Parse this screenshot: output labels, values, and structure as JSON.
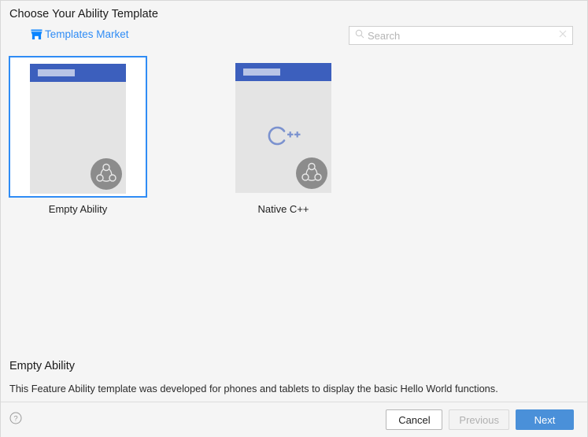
{
  "header": {
    "title": "Choose Your Ability Template",
    "market_link_label": "Templates Market",
    "market_icon": "shop-icon"
  },
  "search": {
    "placeholder": "Search",
    "value": "",
    "search_icon": "search-icon",
    "clear_icon": "close-icon"
  },
  "templates": [
    {
      "label": "Empty Ability",
      "selected": true,
      "preview_kind": "blank",
      "badge_icon": "harmony-ability-icon"
    },
    {
      "label": "Native C++",
      "selected": false,
      "preview_kind": "cpp",
      "preview_glyph": "C++",
      "badge_icon": "harmony-ability-icon"
    }
  ],
  "description": {
    "title": "Empty Ability",
    "text": "This Feature Ability template was developed for phones and tablets to display the basic Hello World functions."
  },
  "footer": {
    "help_icon": "help-icon",
    "cancel_label": "Cancel",
    "previous_label": "Previous",
    "next_label": "Next"
  },
  "colors": {
    "page_background": "#f5f5f5",
    "accent_blue": "#2f8cf5",
    "primary_button": "#4a90d9",
    "phone_header_blue": "#3c5fbd",
    "phone_body_gray": "#e4e4e4",
    "badge_gray": "#8c8c8c",
    "cpp_logo_blue": "#7b92cf"
  }
}
